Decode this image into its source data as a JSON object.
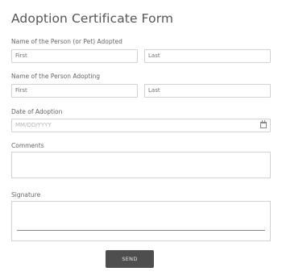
{
  "form": {
    "title": "Adoption Certificate Form",
    "adopted": {
      "label": "Name of the Person (or Pet) Adopted",
      "first_value": "First",
      "last_value": "Last"
    },
    "adopting": {
      "label": "Name of the Person Adopting",
      "first_value": "First",
      "last_value": "Last"
    },
    "date": {
      "label": "Date of Adoption",
      "placeholder": "MM/DD/YYYY",
      "icon": "calendar-icon"
    },
    "comments": {
      "label": "Comments",
      "value": ""
    },
    "signature": {
      "label": "Signature"
    },
    "send_label": "SEND"
  },
  "colors": {
    "button_bg": "#4e4e4e",
    "button_text": "#e8e8e8",
    "input_border": "#d2d2d2",
    "text": "#555555"
  }
}
